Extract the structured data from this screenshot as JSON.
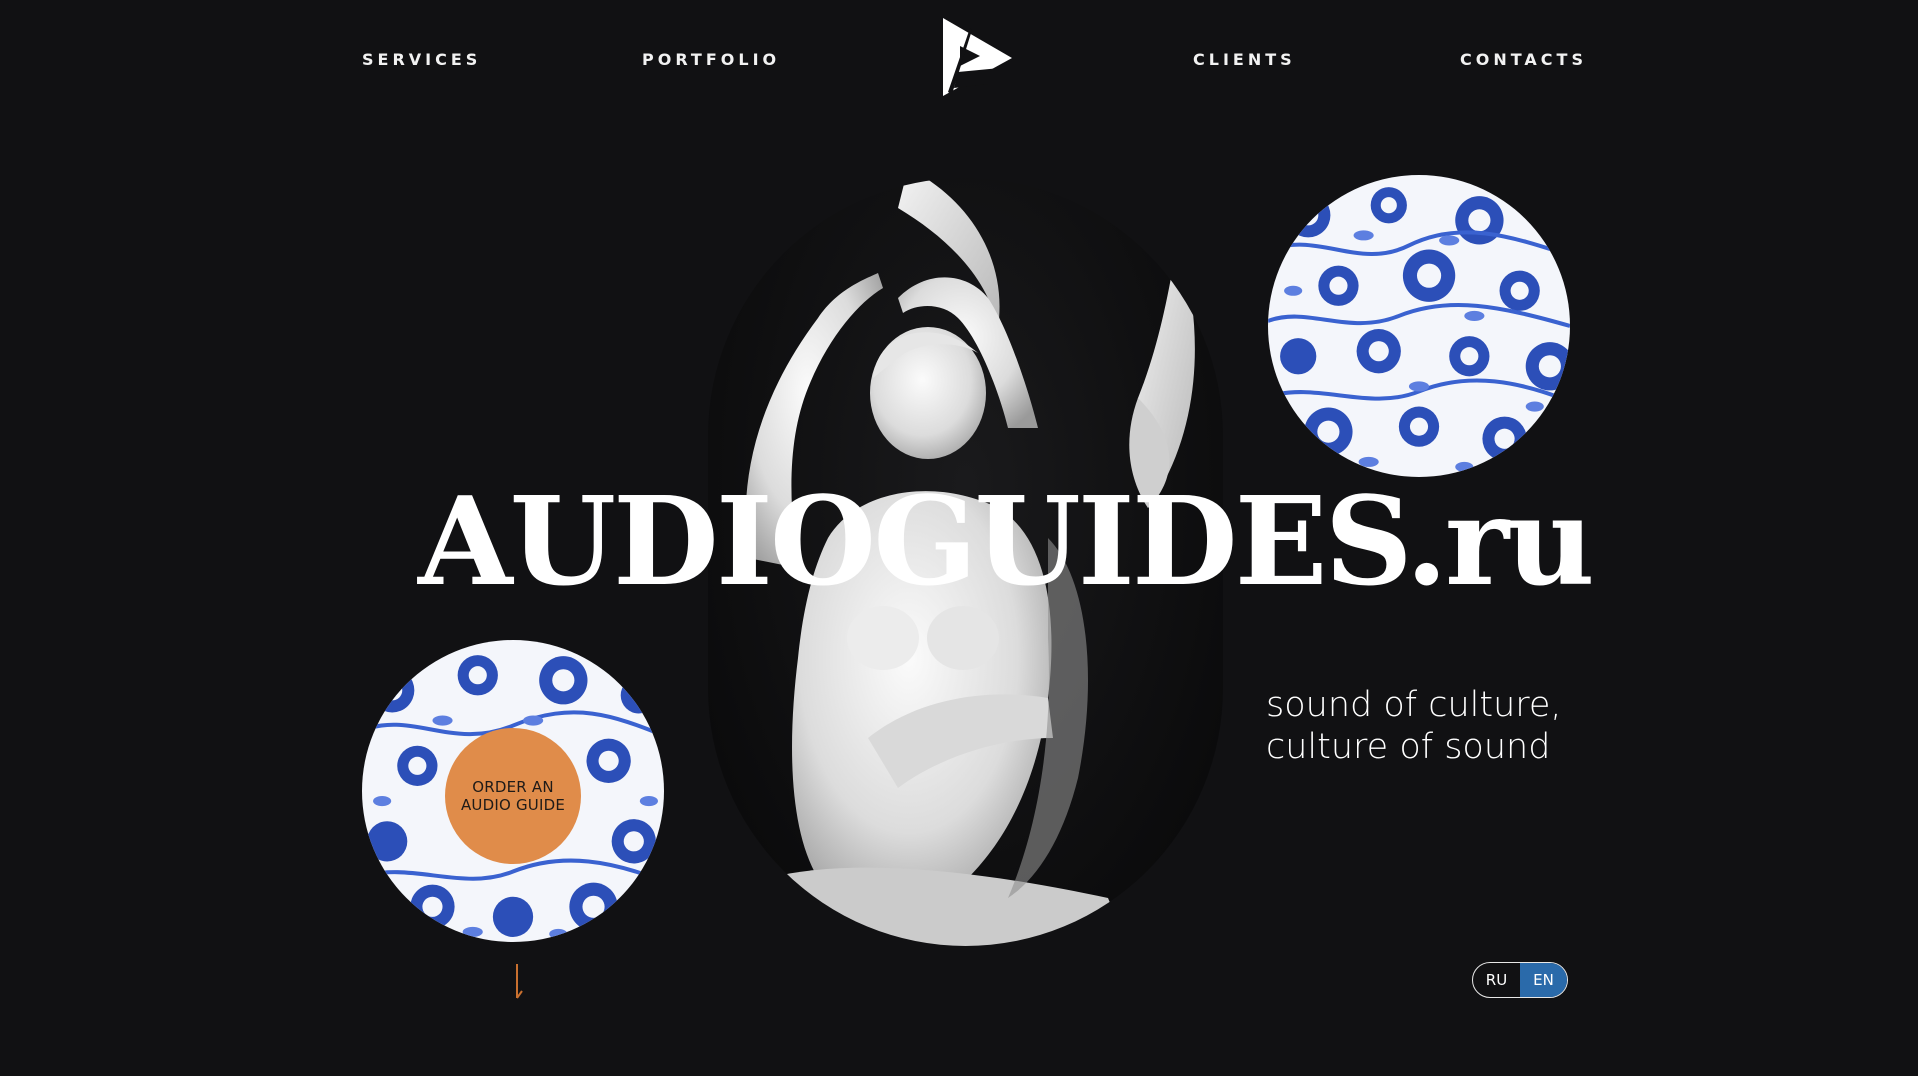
{
  "nav": {
    "services": "SERVICES",
    "portfolio": "PORTFOLIO",
    "clients": "CLIENTS",
    "contacts": "CONTACTS"
  },
  "hero": {
    "title": "AUDIOGUIDES.ru",
    "tagline_line1": "sound of culture,",
    "tagline_line2": "culture of sound",
    "order_button": "ORDER AN AUDIO GUIDE"
  },
  "language": {
    "options": [
      "RU",
      "EN"
    ],
    "selected": "EN"
  },
  "colors": {
    "background": "#111113",
    "accent_orange": "#e08c4a",
    "active_language": "#2a6aaa",
    "pattern_blue": "#2c4fb8"
  },
  "icons": {
    "logo": "logo-icon",
    "scroll": "arrow-down-icon"
  }
}
